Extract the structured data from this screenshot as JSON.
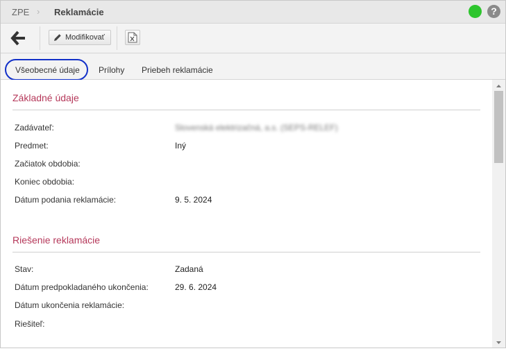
{
  "breadcrumb": {
    "root": "ZPE",
    "separator": "›",
    "current": "Reklamácie"
  },
  "header": {
    "status_color": "#2dc52d",
    "help_symbol": "?"
  },
  "toolbar": {
    "modify_label": "Modifikovať",
    "back_icon": "arrow-left-icon",
    "edit_icon": "pencil-icon",
    "export_icon": "excel-export-icon"
  },
  "tabs": [
    {
      "label": "Všeobecné údaje"
    },
    {
      "label": "Prílohy"
    },
    {
      "label": "Priebeh reklamácie"
    }
  ],
  "basic": {
    "title": "Základné údaje",
    "fields": [
      {
        "label": "Zadávateľ:",
        "value": "Slovenská elektrizačná, a.s. (SEPS-RELEF)"
      },
      {
        "label": "Predmet:",
        "value": "Iný"
      },
      {
        "label": "Začiatok obdobia:",
        "value": ""
      },
      {
        "label": "Koniec obdobia:",
        "value": ""
      },
      {
        "label": "Dátum podania reklamácie:",
        "value": "9. 5. 2024"
      }
    ]
  },
  "resolution": {
    "title": "Riešenie reklamácie",
    "fields": [
      {
        "label": "Stav:",
        "value": "Zadaná"
      },
      {
        "label": "Dátum predpokladaného ukončenia:",
        "value": "29. 6. 2024"
      },
      {
        "label": "Dátum ukončenia reklamácie:",
        "value": ""
      },
      {
        "label": "Riešiteľ:",
        "value": ""
      }
    ]
  },
  "colors": {
    "accent": "#b5385a",
    "highlight": "#1230c8"
  }
}
